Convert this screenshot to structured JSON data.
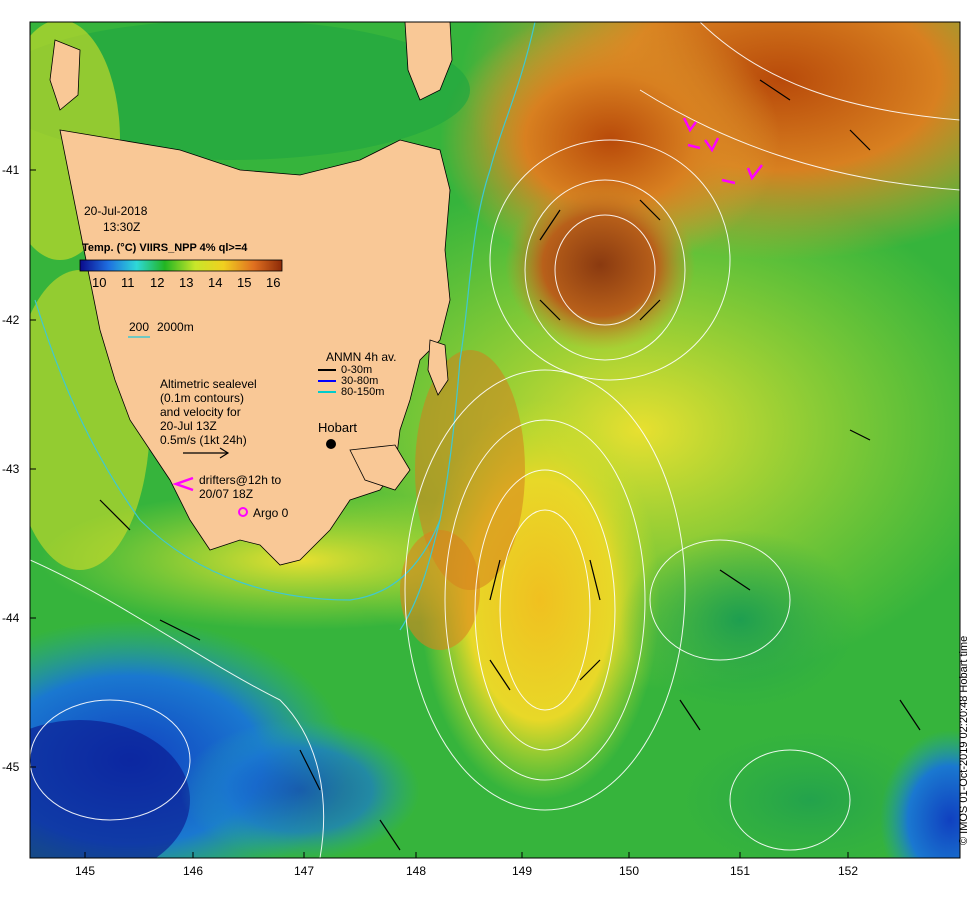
{
  "map": {
    "date": "20-Jul-2018",
    "time": "13:30Z",
    "colorbar_title": "Temp. (°C) VIIRS_NPP 4% ql>=4",
    "colorbar_ticks": [
      "10",
      "11",
      "12",
      "13",
      "14",
      "15",
      "16"
    ],
    "colorbar_colors": [
      "#0a0a8c",
      "#1e6fe0",
      "#2ed8d8",
      "#22b522",
      "#c8e62a",
      "#f0d020",
      "#e07020",
      "#8c2a08"
    ],
    "isobath_label_a": "200",
    "isobath_label_b": "2000m",
    "sealevel_note": "Altimetric sealevel\n(0.1m contours)\nand velocity for\n20-Jul 13Z\n0.5m/s (1kt 24h)",
    "anmn_title": "ANMN 4h av.",
    "anmn_items": [
      {
        "label": "0-30m",
        "color": "#000000"
      },
      {
        "label": "30-80m",
        "color": "#0000ff"
      },
      {
        "label": "80-150m",
        "color": "#00cccc"
      }
    ],
    "place_label": "Hobart",
    "drifters_note": "drifters@12h to\n20/07 18Z",
    "argo_label": "Argo 0",
    "credit": "© IMOS 01-Oct-2019 02:20:48 Hobart time",
    "x_ticks": [
      "145",
      "146",
      "147",
      "148",
      "149",
      "150",
      "151",
      "152"
    ],
    "y_ticks": [
      "-41",
      "-42",
      "-43",
      "-44",
      "-45"
    ],
    "colors": {
      "land": "#f9c896",
      "drifter": "#ff00ff",
      "contour": "#ffffff",
      "isobath": "#40c8d0"
    }
  }
}
